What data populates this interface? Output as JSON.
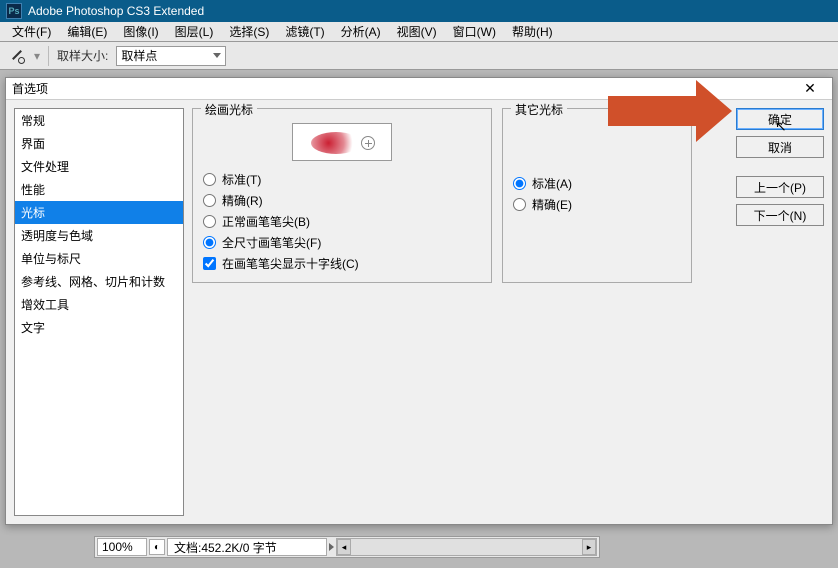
{
  "titlebar": {
    "app_name": "Adobe Photoshop CS3 Extended"
  },
  "menubar": [
    "文件(F)",
    "编辑(E)",
    "图像(I)",
    "图层(L)",
    "选择(S)",
    "滤镜(T)",
    "分析(A)",
    "视图(V)",
    "窗口(W)",
    "帮助(H)"
  ],
  "toolbar": {
    "sample_size_label": "取样大小:",
    "sample_size_value": "取样点"
  },
  "dialog": {
    "title": "首选项",
    "categories": [
      "常规",
      "界面",
      "文件处理",
      "性能",
      "光标",
      "透明度与色域",
      "单位与标尺",
      "参考线、网格、切片和计数",
      "增效工具",
      "文字"
    ],
    "selected_category": "光标",
    "paint_group": {
      "title": "绘画光标",
      "radios": [
        {
          "label": "标准(T)",
          "checked": false
        },
        {
          "label": "精确(R)",
          "checked": false
        },
        {
          "label": "正常画笔笔尖(B)",
          "checked": false
        },
        {
          "label": "全尺寸画笔笔尖(F)",
          "checked": true
        }
      ],
      "checkbox": {
        "label": "在画笔笔尖显示十字线(C)",
        "checked": true
      }
    },
    "other_group": {
      "title": "其它光标",
      "radios": [
        {
          "label": "标准(A)",
          "checked": true
        },
        {
          "label": "精确(E)",
          "checked": false
        }
      ]
    },
    "buttons": {
      "ok": "确定",
      "cancel": "取消",
      "prev": "上一个(P)",
      "next": "下一个(N)"
    }
  },
  "status": {
    "zoom": "100%",
    "doc": "文档:452.2K/0 字节"
  }
}
